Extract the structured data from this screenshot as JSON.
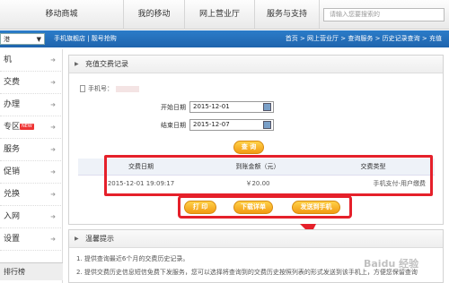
{
  "topnav": {
    "tabs": [
      "移动商城",
      "我的移动",
      "网上营业厅",
      "服务与支持"
    ],
    "search_placeholder": "请输入您要搜索的"
  },
  "bluebar": {
    "select_value": "港",
    "links": "手机旗舰店 | 靓号抢购",
    "breadcrumb": "首页 > 网上营业厅 > 查询服务 > 历史记录查询 > 充值"
  },
  "sidebar": {
    "items": [
      {
        "label": "机"
      },
      {
        "label": "交费"
      },
      {
        "label": "办理"
      },
      {
        "label": "专区",
        "badge": "NEW"
      },
      {
        "label": "服务"
      },
      {
        "label": "促销"
      },
      {
        "label": "兑换"
      },
      {
        "label": "入网"
      },
      {
        "label": "设置"
      }
    ],
    "rank_label": "排行榜"
  },
  "panel": {
    "title": "充值交费记录",
    "phone_label": "手机号："
  },
  "form": {
    "start_label": "开始日期",
    "start_value": "2015-12-01",
    "end_label": "结束日期",
    "end_value": "2015-12-07",
    "query_button": "查 询"
  },
  "table": {
    "headers": [
      "交费日期",
      "到账金额（元）",
      "交费类型"
    ],
    "rows": [
      [
        "2015-12-01 19:09:17",
        "￥20.00",
        "手机支付-用户缴费"
      ]
    ]
  },
  "actions": {
    "print": "打 印",
    "download": "下载详单",
    "send_to_phone": "发送到手机"
  },
  "tips": {
    "title": "温馨提示",
    "lines": [
      "1. 提供查询最近6个月的交费历史记录。",
      "2. 提供交费历史信息短信免费下发服务，您可以选择将查询到的交费历史按照列表的形式发送到该手机上，方便您保留查询"
    ]
  },
  "watermark": "Baidu 经验",
  "colors": {
    "accent_blue": "#2270bd",
    "button_orange": "#f29a12",
    "highlight_red": "#e5202a"
  }
}
